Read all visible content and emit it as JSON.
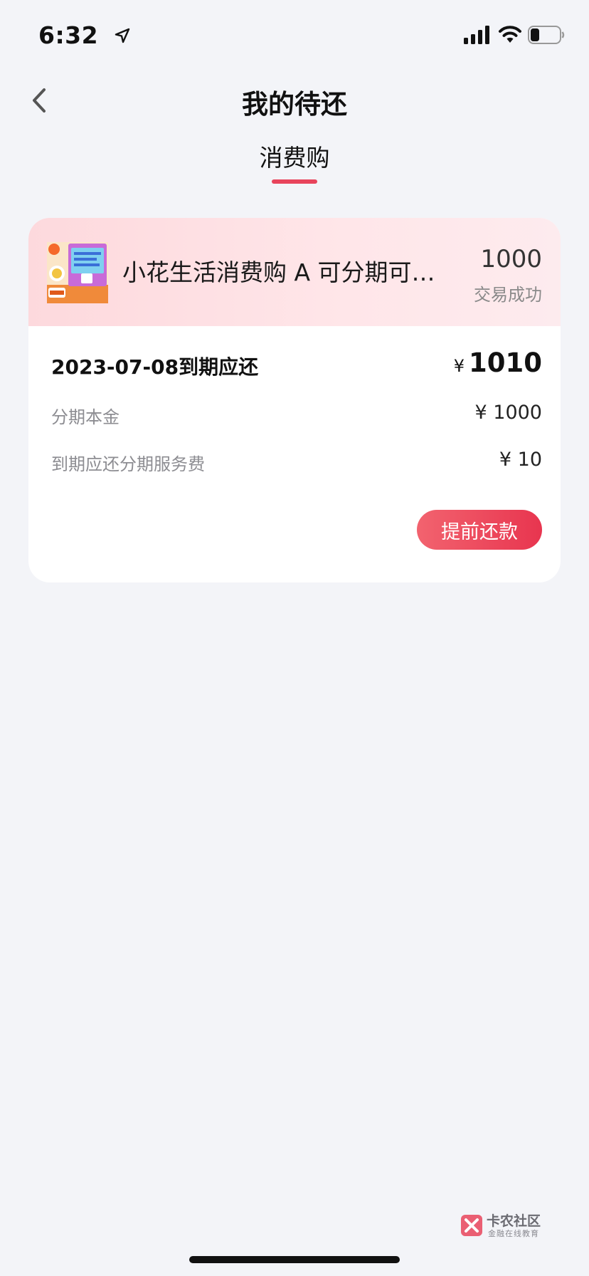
{
  "status_bar": {
    "time": "6:32",
    "icons": [
      "location-arrow-icon",
      "cellular-signal-icon",
      "wifi-icon",
      "battery-icon"
    ],
    "battery_level": 0.3
  },
  "nav": {
    "back_icon": "chevron-left-icon",
    "title": "我的待还"
  },
  "tabs": [
    {
      "label": "消费购",
      "active": true
    }
  ],
  "order": {
    "product_name": "小花生活消费购 A 可分期可…",
    "amount": "1000",
    "status": "交易成功",
    "due_title": "2023-07-08到期应还",
    "due_currency": "¥",
    "due_amount": "1010",
    "rows": [
      {
        "label": "分期本金",
        "value": "¥ 1000"
      },
      {
        "label": "到期应还分期服务费",
        "value": "¥ 10"
      }
    ],
    "prepay_button": "提前还款"
  },
  "watermark": {
    "title": "卡农社区",
    "subtitle": "金融在线教育"
  },
  "colors": {
    "accent": "#e8445c",
    "background": "#f3f4f8",
    "card_header": "#fdd9dd"
  }
}
